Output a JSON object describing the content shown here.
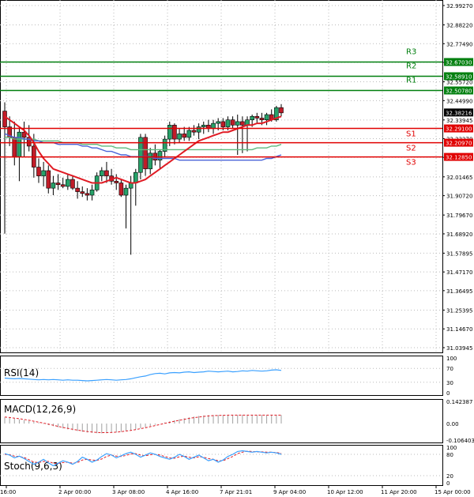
{
  "chart_data": {
    "type": "candlestick",
    "main": {
      "y_ticks": [
        "32.99270",
        "32.88220",
        "32.77490",
        "32.66810",
        "32.55720",
        "32.44990",
        "32.33945",
        "32.23270",
        "32.12600",
        "32.01465",
        "31.90720",
        "31.79670",
        "31.68920",
        "31.57895",
        "31.47170",
        "31.36495",
        "31.25395",
        "31.14670",
        "31.03945"
      ],
      "ylim": [
        31.03945,
        32.9927
      ],
      "current_price": "32.38216",
      "levels": [
        {
          "name": "R3",
          "value": 32.6703,
          "label": "32.67030",
          "color": "#007f0e"
        },
        {
          "name": "R2",
          "value": 32.5891,
          "label": "32.58910",
          "color": "#007f0e"
        },
        {
          "name": "R1",
          "value": 32.5078,
          "label": "32.50780",
          "color": "#007f0e"
        },
        {
          "name": "S1",
          "value": 32.291,
          "label": "32.29100",
          "color": "#e00000"
        },
        {
          "name": "S2",
          "value": 32.2097,
          "label": "32.20970",
          "color": "#e00000"
        },
        {
          "name": "S3",
          "value": 32.1285,
          "label": "32.12850",
          "color": "#e00000"
        }
      ],
      "candles": [
        [
          32.39,
          32.44,
          31.69,
          32.3
        ],
        [
          32.3,
          32.36,
          32.19,
          32.24
        ],
        [
          32.24,
          32.33,
          32.08,
          32.13
        ],
        [
          32.13,
          32.3,
          31.99,
          32.27
        ],
        [
          32.27,
          32.33,
          32.13,
          32.24
        ],
        [
          32.24,
          32.31,
          32.16,
          32.19
        ],
        [
          32.19,
          32.26,
          32.01,
          32.07
        ],
        [
          32.07,
          32.12,
          31.98,
          32.02
        ],
        [
          32.02,
          32.1,
          31.96,
          32.05
        ],
        [
          32.05,
          32.08,
          31.92,
          31.95
        ],
        [
          31.95,
          32.02,
          31.91,
          31.98
        ],
        [
          31.98,
          32.03,
          31.94,
          31.97
        ],
        [
          31.97,
          32.01,
          31.95,
          31.96
        ],
        [
          31.96,
          32.03,
          31.94,
          32.0
        ],
        [
          32.0,
          32.02,
          31.94,
          31.95
        ],
        [
          31.95,
          31.99,
          31.89,
          31.93
        ],
        [
          31.93,
          31.96,
          31.9,
          31.92
        ],
        [
          31.92,
          31.95,
          31.88,
          31.91
        ],
        [
          31.91,
          31.97,
          31.88,
          31.94
        ],
        [
          31.94,
          32.04,
          31.93,
          32.02
        ],
        [
          32.02,
          32.07,
          31.99,
          32.05
        ],
        [
          32.05,
          32.1,
          31.98,
          32.02
        ],
        [
          32.02,
          32.06,
          31.97,
          31.99
        ],
        [
          31.99,
          32.03,
          31.94,
          31.98
        ],
        [
          31.98,
          32.0,
          31.9,
          31.91
        ],
        [
          31.91,
          31.97,
          31.72,
          31.95
        ],
        [
          31.95,
          32.02,
          31.57,
          31.98
        ],
        [
          31.98,
          32.06,
          31.85,
          32.04
        ],
        [
          32.04,
          32.26,
          32.0,
          32.24
        ],
        [
          32.24,
          32.26,
          32.02,
          32.06
        ],
        [
          32.06,
          32.18,
          32.03,
          32.15
        ],
        [
          32.15,
          32.2,
          32.08,
          32.11
        ],
        [
          32.11,
          32.17,
          32.06,
          32.16
        ],
        [
          32.16,
          32.25,
          32.13,
          32.23
        ],
        [
          32.23,
          32.33,
          32.19,
          32.31
        ],
        [
          32.31,
          32.32,
          32.2,
          32.23
        ],
        [
          32.23,
          32.29,
          32.21,
          32.26
        ],
        [
          32.26,
          32.3,
          32.22,
          32.24
        ],
        [
          32.24,
          32.3,
          32.22,
          32.28
        ],
        [
          32.28,
          32.31,
          32.25,
          32.27
        ],
        [
          32.27,
          32.32,
          32.23,
          32.3
        ],
        [
          32.3,
          32.33,
          32.26,
          32.31
        ],
        [
          32.31,
          32.34,
          32.27,
          32.29
        ],
        [
          32.29,
          32.34,
          32.26,
          32.32
        ],
        [
          32.32,
          32.35,
          32.28,
          32.33
        ],
        [
          32.33,
          32.35,
          32.28,
          32.3
        ],
        [
          32.3,
          32.36,
          32.28,
          32.34
        ],
        [
          32.34,
          32.36,
          32.29,
          32.31
        ],
        [
          32.31,
          32.37,
          32.14,
          32.33
        ],
        [
          32.33,
          32.36,
          32.15,
          32.31
        ],
        [
          32.31,
          32.36,
          32.16,
          32.34
        ],
        [
          32.34,
          32.37,
          32.3,
          32.36
        ],
        [
          32.36,
          32.38,
          32.32,
          32.35
        ],
        [
          32.35,
          32.38,
          32.31,
          32.34
        ],
        [
          32.34,
          32.38,
          32.31,
          32.37
        ],
        [
          32.37,
          32.4,
          32.33,
          32.34
        ],
        [
          32.34,
          32.42,
          32.33,
          32.41
        ],
        [
          32.41,
          32.43,
          32.36,
          32.38
        ]
      ],
      "ma_red": [
        32.36,
        32.34,
        32.32,
        32.3,
        32.28,
        32.25,
        32.21,
        32.16,
        32.12,
        32.09,
        32.06,
        32.05,
        32.04,
        32.03,
        32.02,
        32.01,
        32.0,
        31.99,
        31.98,
        31.98,
        31.98,
        31.99,
        32.0,
        32.01,
        32.0,
        31.99,
        31.98,
        31.98,
        31.99,
        32.0,
        32.02,
        32.04,
        32.06,
        32.08,
        32.1,
        32.12,
        32.14,
        32.16,
        32.18,
        32.2,
        32.22,
        32.23,
        32.24,
        32.25,
        32.26,
        32.27,
        32.27,
        32.28,
        32.29,
        32.3,
        32.31,
        32.31,
        32.32,
        32.32,
        32.33,
        32.34,
        32.35,
        32.36
      ],
      "ma_blue": [
        32.26,
        32.25,
        32.24,
        32.24,
        32.23,
        32.23,
        32.22,
        32.22,
        32.21,
        32.21,
        32.21,
        32.2,
        32.2,
        32.2,
        32.2,
        32.2,
        32.19,
        32.19,
        32.18,
        32.18,
        32.17,
        32.16,
        32.16,
        32.15,
        32.14,
        32.14,
        32.13,
        32.13,
        32.13,
        32.13,
        32.13,
        32.12,
        32.12,
        32.12,
        32.12,
        32.12,
        32.11,
        32.11,
        32.11,
        32.11,
        32.11,
        32.11,
        32.11,
        32.11,
        32.11,
        32.11,
        32.11,
        32.11,
        32.11,
        32.11,
        32.11,
        32.11,
        32.11,
        32.11,
        32.12,
        32.12,
        32.13,
        32.14
      ],
      "ma_green": [
        32.24,
        32.24,
        32.23,
        32.23,
        32.23,
        32.23,
        32.23,
        32.22,
        32.22,
        32.22,
        32.22,
        32.22,
        32.21,
        32.21,
        32.21,
        32.21,
        32.2,
        32.2,
        32.2,
        32.2,
        32.19,
        32.19,
        32.19,
        32.18,
        32.18,
        32.18,
        32.17,
        32.17,
        32.17,
        32.17,
        32.17,
        32.17,
        32.17,
        32.17,
        32.17,
        32.17,
        32.17,
        32.17,
        32.17,
        32.17,
        32.17,
        32.17,
        32.17,
        32.17,
        32.17,
        32.17,
        32.17,
        32.17,
        32.17,
        32.17,
        32.17,
        32.17,
        32.18,
        32.18,
        32.18,
        32.19,
        32.19,
        32.2
      ]
    },
    "rsi": {
      "label": "RSI(14)",
      "y_ticks": [
        "100",
        "70",
        "30",
        "0"
      ],
      "levels": [
        70,
        30
      ],
      "values": [
        42,
        41,
        40,
        41,
        40,
        39,
        38,
        37,
        38,
        37,
        38,
        37,
        36,
        37,
        36,
        36,
        35,
        34,
        35,
        36,
        37,
        38,
        37,
        36,
        37,
        38,
        40,
        43,
        46,
        48,
        52,
        55,
        56,
        54,
        57,
        58,
        57,
        59,
        60,
        58,
        59,
        60,
        62,
        61,
        60,
        61,
        62,
        60,
        61,
        63,
        62,
        64,
        63,
        62,
        63,
        65,
        66,
        64
      ]
    },
    "macd": {
      "label": "MACD(12,26,9)",
      "y_ticks": [
        "0.142387",
        "0.00",
        "-0.106403"
      ],
      "ylim": [
        -0.106403,
        0.142387
      ],
      "histogram": [
        0.04,
        0.036,
        0.032,
        0.027,
        0.022,
        0.016,
        0.01,
        0.004,
        -0.003,
        -0.01,
        -0.017,
        -0.024,
        -0.031,
        -0.037,
        -0.043,
        -0.048,
        -0.053,
        -0.057,
        -0.06,
        -0.062,
        -0.063,
        -0.062,
        -0.06,
        -0.057,
        -0.053,
        -0.049,
        -0.044,
        -0.038,
        -0.031,
        -0.024,
        -0.016,
        -0.008,
        0.0,
        0.007,
        0.014,
        0.021,
        0.028,
        0.034,
        0.04,
        0.045,
        0.049,
        0.052,
        0.054,
        0.055,
        0.055,
        0.055,
        0.055,
        0.055,
        0.055,
        0.055,
        0.055,
        0.055,
        0.055,
        0.055,
        0.055,
        0.055,
        0.055,
        0.055
      ],
      "signal": [
        0.042,
        0.039,
        0.035,
        0.031,
        0.026,
        0.021,
        0.015,
        0.009,
        0.003,
        -0.004,
        -0.011,
        -0.018,
        -0.025,
        -0.031,
        -0.037,
        -0.042,
        -0.047,
        -0.051,
        -0.054,
        -0.057,
        -0.058,
        -0.058,
        -0.057,
        -0.055,
        -0.052,
        -0.048,
        -0.044,
        -0.039,
        -0.033,
        -0.027,
        -0.02,
        -0.013,
        -0.006,
        0.001,
        0.008,
        0.015,
        0.021,
        0.027,
        0.033,
        0.038,
        0.042,
        0.046,
        0.049,
        0.051,
        0.052,
        0.053,
        0.054,
        0.054,
        0.054,
        0.054,
        0.054,
        0.054,
        0.054,
        0.054,
        0.054,
        0.054,
        0.054,
        0.054
      ]
    },
    "stoch": {
      "label": "Stoch(9,6,3)",
      "y_ticks": [
        "100",
        "80",
        "20",
        "0"
      ],
      "levels": [
        80,
        20
      ],
      "k": [
        82,
        78,
        70,
        75,
        68,
        60,
        52,
        58,
        66,
        56,
        48,
        55,
        62,
        58,
        52,
        60,
        72,
        66,
        58,
        64,
        74,
        82,
        78,
        70,
        76,
        82,
        86,
        80,
        72,
        78,
        84,
        80,
        74,
        70,
        66,
        72,
        80,
        74,
        66,
        72,
        78,
        70,
        62,
        66,
        58,
        64,
        74,
        80,
        88,
        90,
        88,
        86,
        88,
        86,
        84,
        86,
        84,
        80
      ],
      "d": [
        80,
        79,
        75,
        74,
        71,
        65,
        58,
        57,
        60,
        60,
        55,
        54,
        57,
        58,
        55,
        57,
        64,
        66,
        64,
        63,
        67,
        74,
        78,
        75,
        74,
        77,
        81,
        82,
        78,
        76,
        79,
        80,
        78,
        74,
        70,
        69,
        73,
        75,
        72,
        70,
        73,
        72,
        68,
        66,
        62,
        62,
        68,
        74,
        82,
        86,
        89,
        88,
        87,
        87,
        86,
        86,
        85,
        83
      ]
    },
    "x_labels": [
      "16:00",
      "2 Apr 00:00",
      "3 Apr 08:00",
      "4 Apr 16:00",
      "7 Apr 21:01",
      "9 Apr 04:00",
      "10 Apr 12:00",
      "11 Apr 20:00",
      "15 Apr 00:00"
    ]
  }
}
